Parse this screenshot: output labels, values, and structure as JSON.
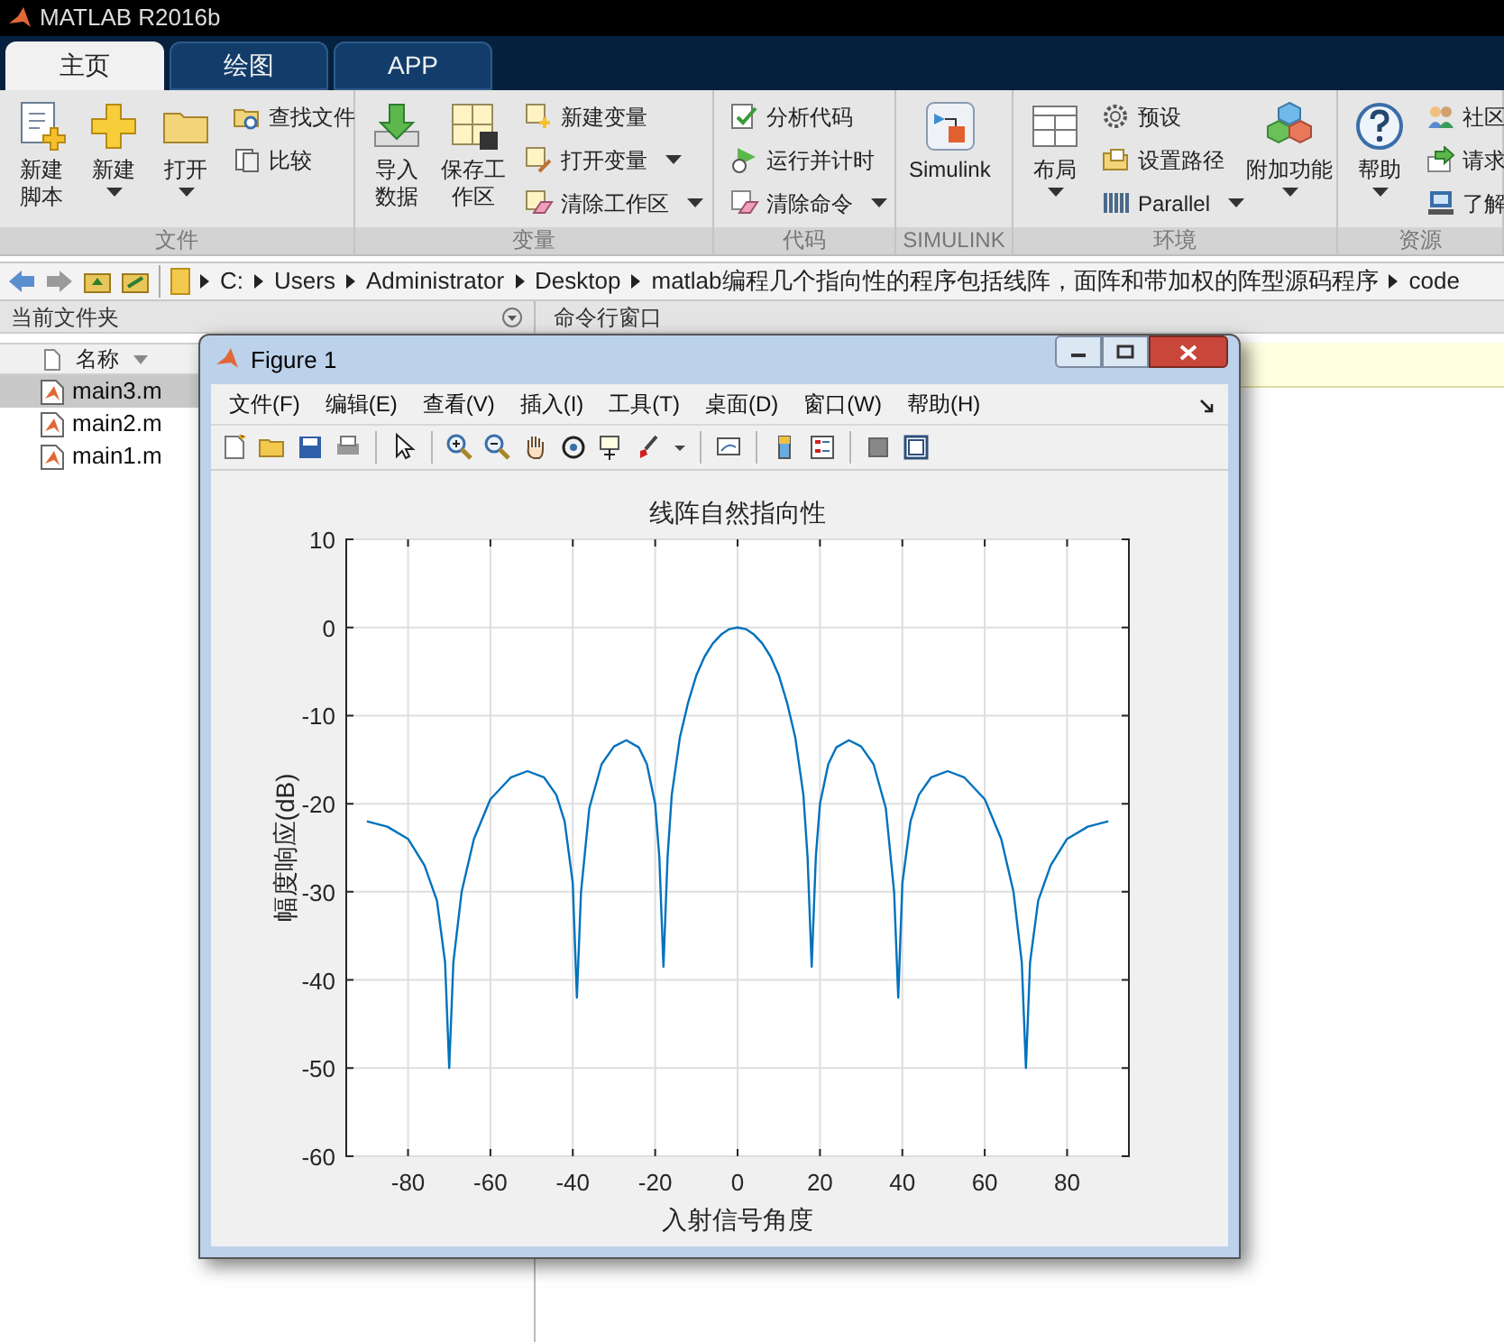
{
  "app_title": "MATLAB R2016b",
  "tabs": [
    {
      "label": "主页",
      "selected": true
    },
    {
      "label": "绘图",
      "selected": false
    },
    {
      "label": "APP",
      "selected": false
    }
  ],
  "ribbon_groups": [
    {
      "label": "文件",
      "items": [
        {
          "kind": "large",
          "label": "新建脚本",
          "wrap": true,
          "dropdown": false
        },
        {
          "kind": "large",
          "label": "新建",
          "dropdown": true
        },
        {
          "kind": "large",
          "label": "打开",
          "dropdown": true
        },
        {
          "kind": "stack",
          "items": [
            {
              "label": "查找文件",
              "dropdown": false
            },
            {
              "label": "比较",
              "dropdown": false
            }
          ]
        }
      ]
    },
    {
      "label": "变量",
      "items": [
        {
          "kind": "large",
          "label": "导入数据",
          "wrap": true,
          "dropdown": false
        },
        {
          "kind": "large",
          "label": "保存工作区",
          "wrap": true,
          "dropdown": false
        },
        {
          "kind": "stack",
          "items": [
            {
              "label": "新建变量",
              "dropdown": false
            },
            {
              "label": "打开变量",
              "dropdown": true
            },
            {
              "label": "清除工作区",
              "dropdown": true
            }
          ]
        }
      ]
    },
    {
      "label": "代码",
      "items": [
        {
          "kind": "stack",
          "items": [
            {
              "label": "分析代码",
              "dropdown": false
            },
            {
              "label": "运行并计时",
              "dropdown": false
            },
            {
              "label": "清除命令",
              "dropdown": true
            }
          ]
        }
      ]
    },
    {
      "label": "SIMULINK",
      "items": [
        {
          "kind": "large",
          "label": "Simulink",
          "dropdown": false
        }
      ]
    },
    {
      "label": "环境",
      "items": [
        {
          "kind": "large",
          "label": "布局",
          "dropdown": true
        },
        {
          "kind": "stack",
          "items": [
            {
              "label": "预设",
              "dropdown": false
            },
            {
              "label": "设置路径",
              "dropdown": false
            },
            {
              "label": "Parallel",
              "dropdown": true
            }
          ]
        },
        {
          "kind": "large",
          "label": "附加功能",
          "dropdown": true
        }
      ]
    },
    {
      "label": "资源",
      "items": [
        {
          "kind": "large",
          "label": "帮助",
          "dropdown": true
        },
        {
          "kind": "stack",
          "items": [
            {
              "label": "社区",
              "dropdown": false
            },
            {
              "label": "请求",
              "dropdown": false
            },
            {
              "label": "了解",
              "dropdown": false
            }
          ]
        }
      ]
    }
  ],
  "path": [
    "C:",
    "Users",
    "Administrator",
    "Desktop",
    "matlab编程几个指向性的程序包括线阵，面阵和带加权的阵型源码程序",
    "code"
  ],
  "current_folder": {
    "title": "当前文件夹",
    "column": "名称",
    "files": [
      {
        "name": "main3.m",
        "selected": true
      },
      {
        "name": "main2.m",
        "selected": false
      },
      {
        "name": "main1.m",
        "selected": false
      }
    ]
  },
  "command_window": {
    "title": "命令行窗口"
  },
  "figure": {
    "title": "Figure 1",
    "menu": [
      "文件(F)",
      "编辑(E)",
      "查看(V)",
      "插入(I)",
      "工具(T)",
      "桌面(D)",
      "窗口(W)",
      "帮助(H)"
    ],
    "chart_data": {
      "type": "line",
      "title": "线阵自然指向性",
      "xlabel": "入射信号角度",
      "ylabel": "幅度响应(dB)",
      "x": [
        -90,
        -85,
        -80,
        -76,
        -73,
        -71,
        -70,
        -69,
        -67,
        -64,
        -60,
        -55,
        -51,
        -47,
        -44,
        -42,
        -40,
        -39,
        -38,
        -36,
        -33,
        -30,
        -27,
        -24,
        -22,
        -20,
        -19,
        -18,
        -17,
        -16,
        -14,
        -12,
        -10,
        -8,
        -6,
        -4,
        -2,
        0,
        2,
        4,
        6,
        8,
        10,
        12,
        14,
        16,
        17,
        18,
        19,
        20,
        22,
        24,
        27,
        30,
        33,
        36,
        38,
        39,
        40,
        42,
        44,
        47,
        51,
        55,
        60,
        64,
        67,
        69,
        70,
        71,
        73,
        76,
        80,
        85,
        90
      ],
      "series": [
        {
          "color": "#0072bd",
          "values": [
            -22,
            -22.6,
            -24,
            -27,
            -31,
            -38,
            -50,
            -38,
            -30,
            -24,
            -19.5,
            -17,
            -16.3,
            -17,
            -19,
            -22,
            -29,
            -42,
            -30,
            -20.5,
            -15.5,
            -13.5,
            -12.8,
            -13.6,
            -15.5,
            -20,
            -26,
            -38.5,
            -26,
            -19,
            -12.5,
            -8.5,
            -5.4,
            -3.3,
            -1.8,
            -0.8,
            -0.2,
            0,
            -0.2,
            -0.8,
            -1.8,
            -3.3,
            -5.4,
            -8.5,
            -12.5,
            -19,
            -26,
            -38.5,
            -26,
            -20,
            -15.5,
            -13.6,
            -12.8,
            -13.5,
            -15.5,
            -20.5,
            -30,
            -42,
            -29,
            -22,
            -19,
            -17,
            -16.3,
            -17,
            -19.5,
            -24,
            -30,
            -38,
            -50,
            -38,
            -31,
            -27,
            -24,
            -22.6,
            -22
          ]
        }
      ],
      "grid": true,
      "xlim": [
        -95,
        95
      ],
      "ylim": [
        -60,
        10
      ],
      "xticks": [
        -80,
        -60,
        -40,
        -20,
        0,
        20,
        40,
        60,
        80
      ],
      "yticks": [
        -60,
        -50,
        -40,
        -30,
        -20,
        -10,
        0,
        10
      ]
    }
  }
}
